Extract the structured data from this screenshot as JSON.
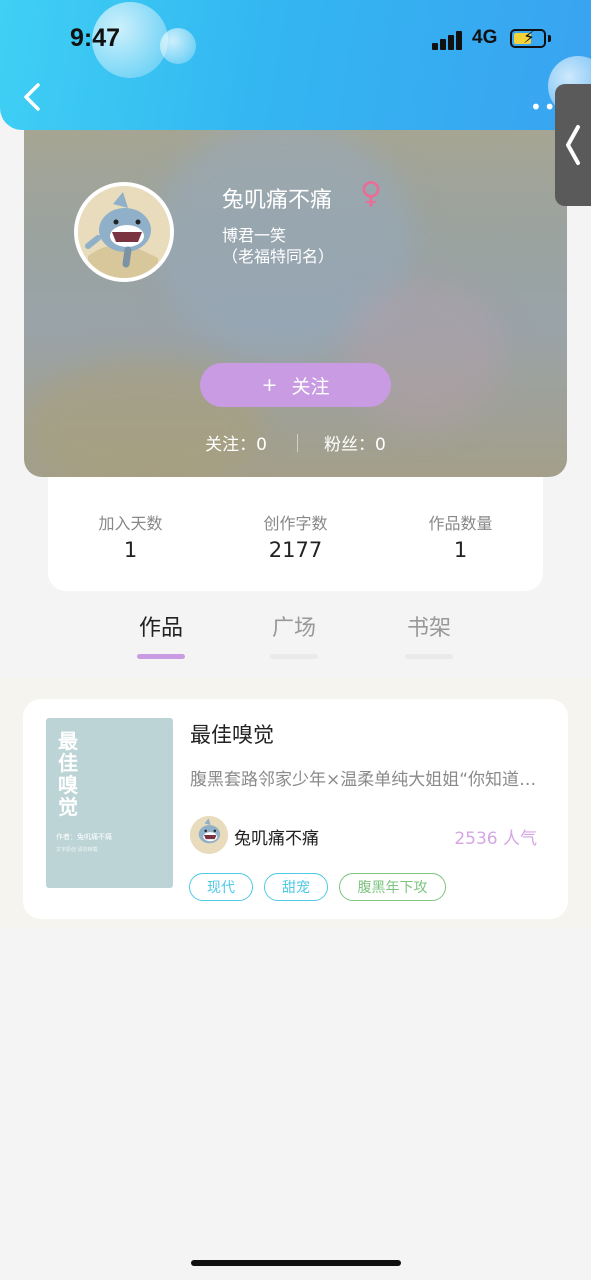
{
  "status_bar": {
    "time": "9:47",
    "network": "4G"
  },
  "header": {
    "back_icon": "chevron-left-icon",
    "more_icon": "more-dots-icon"
  },
  "side_tab": {
    "icon": "chevron-left-icon"
  },
  "profile": {
    "nickname": "兔叽痛不痛",
    "gender_symbol": "♀",
    "bio_line1": "博君一笑",
    "bio_line2": "（老福特同名）",
    "follow_button_plus": "+",
    "follow_button_label": "关注",
    "following": "关注：0",
    "followers": "粉丝：0"
  },
  "stats": [
    {
      "label": "加入天数",
      "value": "1"
    },
    {
      "label": "创作字数",
      "value": "2177"
    },
    {
      "label": "作品数量",
      "value": "1"
    }
  ],
  "tabs": [
    {
      "label": "作品",
      "active": true
    },
    {
      "label": "广场",
      "active": false
    },
    {
      "label": "书架",
      "active": false
    }
  ],
  "works": [
    {
      "cover_title": "最佳嗅觉",
      "cover_author": "作者：兔叽痛不痛",
      "cover_note": "文字原创 请勿转载",
      "title": "最佳嗅觉",
      "description": "腹黑套路邻家少年×温柔单纯大姐姐“你知道吗？",
      "author": "兔叽痛不痛",
      "popularity": "2536 人气",
      "tags": [
        {
          "label": "现代",
          "color": "#4fc9e6"
        },
        {
          "label": "甜宠",
          "color": "#4fc9e6"
        },
        {
          "label": "腹黑年下攻",
          "color": "#7cc47f"
        }
      ]
    }
  ],
  "colors": {
    "accent": "#c99be3",
    "header_blue": "#33b6f1",
    "popularity": "#d5a6e6"
  }
}
